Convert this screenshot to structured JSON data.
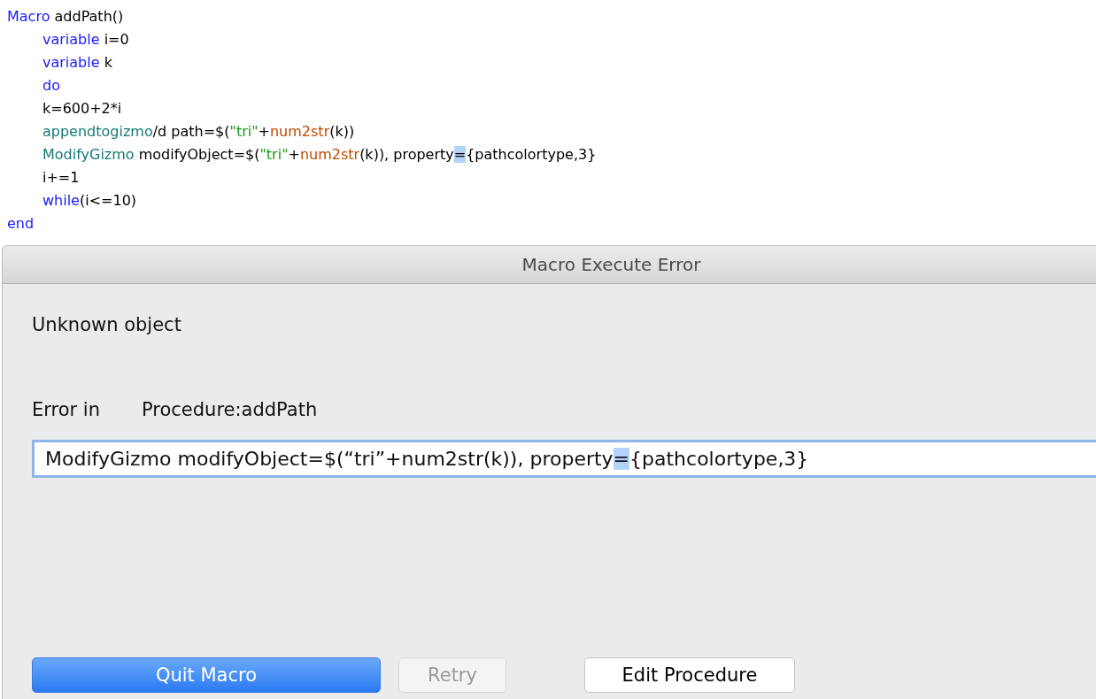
{
  "code_lines": [
    {
      "indent": false,
      "tokens": [
        {
          "kind": "keyword",
          "text": "Macro"
        },
        {
          "kind": "plain",
          "text": " addPath()"
        }
      ]
    },
    {
      "indent": true,
      "tokens": [
        {
          "kind": "keyword",
          "text": "variable"
        },
        {
          "kind": "plain",
          "text": " i=0"
        }
      ]
    },
    {
      "indent": true,
      "tokens": [
        {
          "kind": "keyword",
          "text": "variable"
        },
        {
          "kind": "plain",
          "text": " k"
        }
      ]
    },
    {
      "indent": true,
      "tokens": [
        {
          "kind": "keyword",
          "text": "do"
        }
      ]
    },
    {
      "indent": true,
      "tokens": [
        {
          "kind": "plain",
          "text": "k=600+2*i"
        }
      ]
    },
    {
      "indent": true,
      "tokens": [
        {
          "kind": "operation",
          "text": "appendtogizmo"
        },
        {
          "kind": "plain",
          "text": "/d path=$("
        },
        {
          "kind": "string",
          "text": "\"tri\""
        },
        {
          "kind": "plain",
          "text": "+"
        },
        {
          "kind": "function",
          "text": "num2str"
        },
        {
          "kind": "plain",
          "text": "(k))"
        }
      ]
    },
    {
      "indent": true,
      "tokens": [
        {
          "kind": "operation",
          "text": "ModifyGizmo"
        },
        {
          "kind": "plain",
          "text": " modifyObject=$("
        },
        {
          "kind": "string",
          "text": "\"tri\""
        },
        {
          "kind": "plain",
          "text": "+"
        },
        {
          "kind": "function",
          "text": "num2str"
        },
        {
          "kind": "plain",
          "text": "(k)), property"
        },
        {
          "kind": "selected",
          "text": "="
        },
        {
          "kind": "plain",
          "text": "{pathcolortype,3}"
        }
      ]
    },
    {
      "indent": true,
      "tokens": [
        {
          "kind": "plain",
          "text": "i+=1"
        }
      ]
    },
    {
      "indent": true,
      "tokens": [
        {
          "kind": "keyword",
          "text": "while"
        },
        {
          "kind": "plain",
          "text": "(i<=10)"
        }
      ]
    },
    {
      "indent": false,
      "tokens": [
        {
          "kind": "keyword",
          "text": "end"
        }
      ]
    }
  ],
  "dialog": {
    "title": "Macro Execute Error",
    "message": "Unknown object",
    "error_in_label": "Error in",
    "procedure": "Procedure:addPath",
    "error_line": [
      {
        "text": "ModifyGizmo modifyObject=$(“tri”+num2str(k)), property",
        "selected": false
      },
      {
        "text": "=",
        "selected": true
      },
      {
        "text": "{pathcolortype,3}",
        "selected": false
      }
    ],
    "buttons": [
      {
        "label": "Quit Macro",
        "default": true,
        "disabled": false
      },
      {
        "label": "Retry",
        "default": false,
        "disabled": true
      },
      {
        "label": "Edit Procedure",
        "default": false,
        "disabled": false
      }
    ]
  }
}
